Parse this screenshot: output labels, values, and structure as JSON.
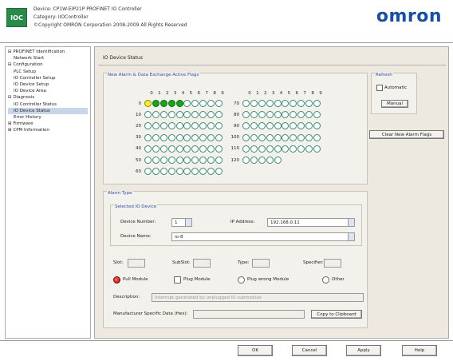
{
  "header": {
    "logo_text": "IOC",
    "line1": "Device: CP1W-EIP21P PROFINET IO Controller",
    "line2": "Category: IIOController",
    "line3": "©Copyright OMRON Corporation 2008-2009 All Rights Reserved",
    "brand": "omron"
  },
  "tree": {
    "items": [
      "⊟ PROFINET Identification",
      "    Network Start",
      "⊟ Configuration",
      "    PLC Setup",
      "    IO Controller Setup",
      "    IO Device Setup",
      "    IO Device Area",
      "⊟ Diagnosis",
      "    IO Controller Status",
      "    IO Device Status",
      "    Error History",
      "⊞ Firmware",
      "⊞ CPM Information"
    ],
    "selected_index": 9
  },
  "main": {
    "title": "IO Device Status",
    "flags_group": "New Alarm & Data Exchange Active Flags",
    "col_digits": [
      "0",
      "1",
      "2",
      "3",
      "4",
      "5",
      "6",
      "7",
      "8",
      "9"
    ],
    "left_rows": [
      "0",
      "10",
      "20",
      "30",
      "40",
      "50",
      "60"
    ],
    "right_rows": [
      "70",
      "80",
      "90",
      "100",
      "110",
      "120"
    ],
    "right_rows_count": [
      10,
      10,
      10,
      10,
      10,
      5
    ],
    "flag_states_row0": [
      "yellow",
      "green",
      "green",
      "green",
      "green",
      "off",
      "off",
      "off",
      "off",
      "off"
    ],
    "refresh": {
      "title": "Refresh",
      "automatic_label": "Automatic",
      "manual_label": "Manual"
    },
    "clear_btn": "Clear New Alarm Flags",
    "alarm": {
      "group_title": "Alarm Type",
      "sub_title": "Selected IO Device",
      "device_number_label": "Device Number:",
      "device_number": "1",
      "ip_label": "IP Address:",
      "ip_value": "192.168.0.11",
      "device_name_label": "Device Name:",
      "device_name": "io-8",
      "slot_label": "Slot:",
      "subslot_label": "SubSlot:",
      "type_label": "Type:",
      "specifier_label": "Specifier:",
      "radio1": "Pull Module",
      "radio2": "Plug Module",
      "radio3": "Plug wrong Module",
      "radio4": "Other",
      "description_label": "Description:",
      "description_value": "Interrupt generated by unplugged IO submodule",
      "mfr_label": "Manufacturer Specific Data (Hex):",
      "copy_btn": "Copy to Clipboard"
    }
  },
  "footer": {
    "ok": "OK",
    "cancel": "Cancel",
    "apply": "Apply",
    "help": "Help"
  }
}
